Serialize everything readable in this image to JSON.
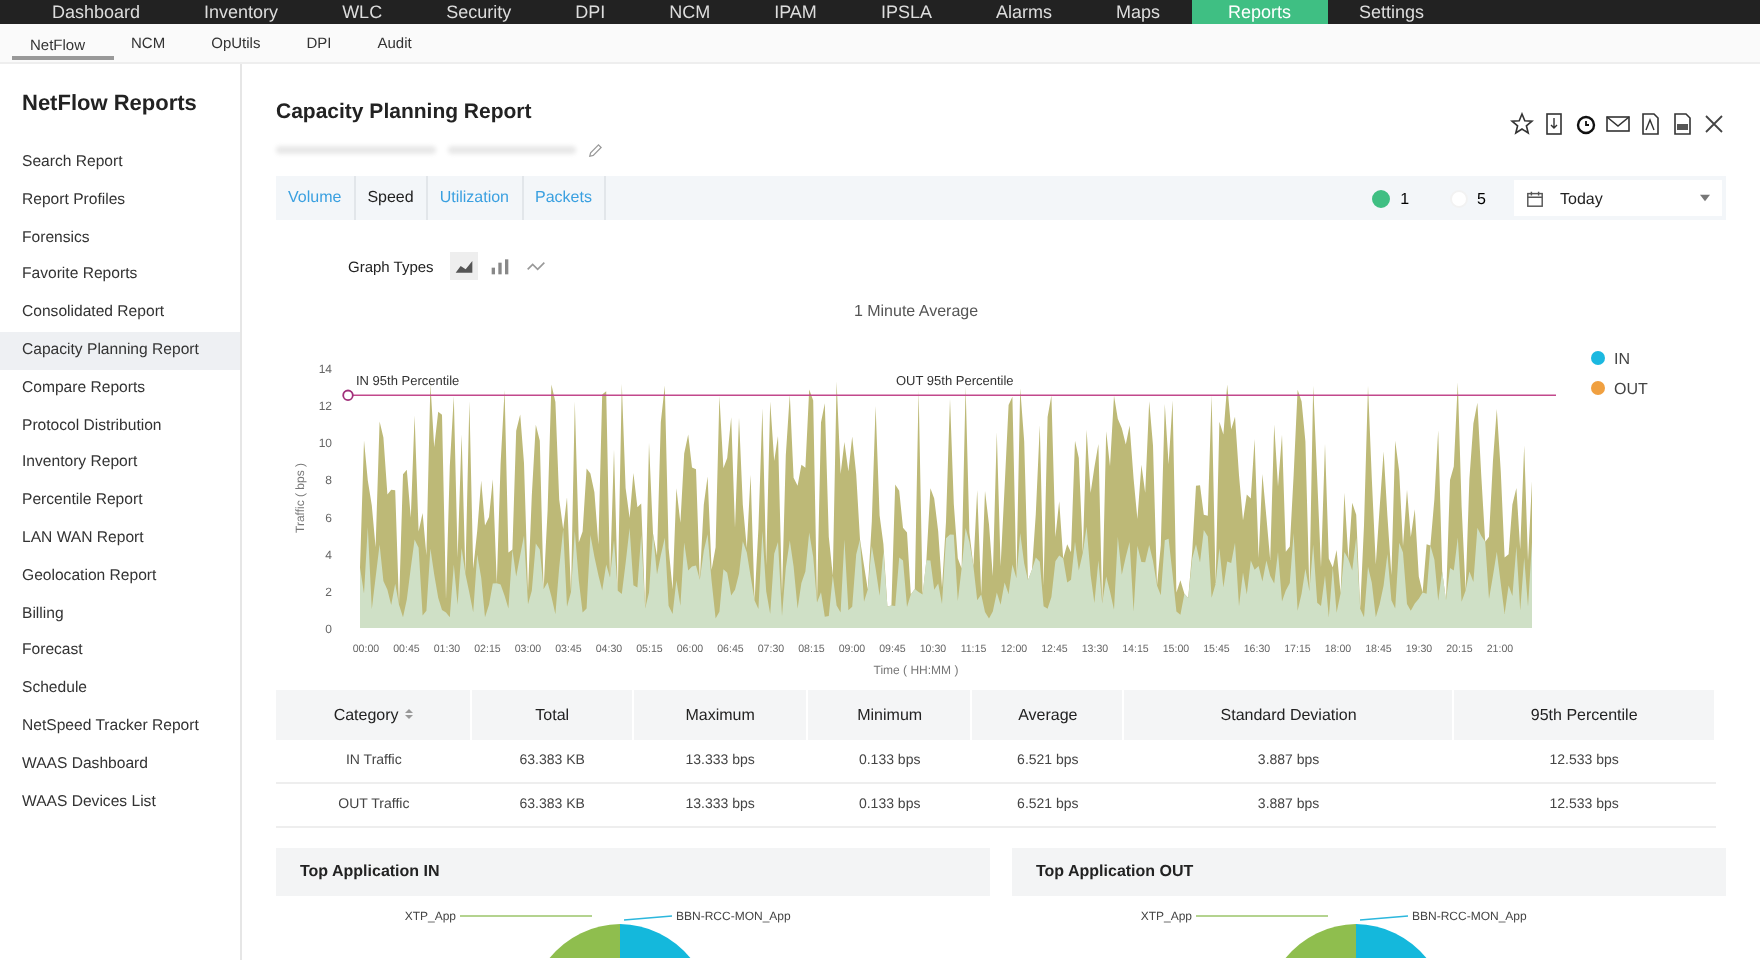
{
  "top_nav": [
    {
      "label": "Dashboard",
      "selected": false
    },
    {
      "label": "Inventory",
      "selected": false
    },
    {
      "label": "WLC",
      "selected": false
    },
    {
      "label": "Security",
      "selected": false
    },
    {
      "label": "DPI",
      "selected": false
    },
    {
      "label": "NCM",
      "selected": false
    },
    {
      "label": "IPAM",
      "selected": false
    },
    {
      "label": "IPSLA",
      "selected": false
    },
    {
      "label": "Alarms",
      "selected": false
    },
    {
      "label": "Maps",
      "selected": false
    },
    {
      "label": "Reports",
      "selected": true
    },
    {
      "label": "Settings",
      "selected": false
    }
  ],
  "sub_nav": [
    {
      "label": "NetFlow",
      "selected": true
    },
    {
      "label": "NCM",
      "selected": false
    },
    {
      "label": "OpUtils",
      "selected": false
    },
    {
      "label": "DPI",
      "selected": false
    },
    {
      "label": "Audit",
      "selected": false
    }
  ],
  "sidebar": {
    "title": "NetFlow Reports",
    "items": [
      {
        "label": "Search Report",
        "selected": false
      },
      {
        "label": "Report Profiles",
        "selected": false
      },
      {
        "label": "Forensics",
        "selected": false
      },
      {
        "label": "Favorite Reports",
        "selected": false
      },
      {
        "label": "Consolidated Report",
        "selected": false
      },
      {
        "label": "Capacity Planning Report",
        "selected": true
      },
      {
        "label": "Compare Reports",
        "selected": false
      },
      {
        "label": "Protocol Distribution",
        "selected": false
      },
      {
        "label": "Inventory Report",
        "selected": false
      },
      {
        "label": "Percentile Report",
        "selected": false
      },
      {
        "label": "LAN WAN Report",
        "selected": false
      },
      {
        "label": "Geolocation Report",
        "selected": false
      },
      {
        "label": "Billing",
        "selected": false
      },
      {
        "label": "Forecast",
        "selected": false
      },
      {
        "label": "Schedule",
        "selected": false
      },
      {
        "label": "NetSpeed Tracker Report",
        "selected": false
      },
      {
        "label": "WAAS Dashboard",
        "selected": false
      },
      {
        "label": "WAAS Devices List",
        "selected": false
      }
    ]
  },
  "report": {
    "title": "Capacity Planning Report"
  },
  "view_tabs": [
    {
      "label": "Volume",
      "selected": false
    },
    {
      "label": "Speed",
      "selected": true
    },
    {
      "label": "Utilization",
      "selected": false
    },
    {
      "label": "Packets",
      "selected": false
    }
  ],
  "intervals": [
    {
      "label": "1",
      "selected": true
    },
    {
      "label": "5",
      "selected": false
    }
  ],
  "date_range": {
    "value": "Today"
  },
  "graph_types": {
    "label": "Graph Types",
    "options": [
      {
        "kind": "area",
        "selected": true
      },
      {
        "kind": "bar",
        "selected": false
      },
      {
        "kind": "line",
        "selected": false
      }
    ]
  },
  "chart": {
    "title": "1 Minute Average",
    "ylabel": "Traffic ( bps )",
    "xlabel": "Time ( HH:MM )",
    "yticks": [
      "14",
      "12",
      "10",
      "8",
      "6",
      "4",
      "2",
      "0"
    ],
    "xticks": [
      "00:00",
      "00:45",
      "01:30",
      "02:15",
      "03:00",
      "03:45",
      "04:30",
      "05:15",
      "06:00",
      "06:45",
      "07:30",
      "08:15",
      "09:00",
      "09:45",
      "10:30",
      "11:15",
      "12:00",
      "12:45",
      "13:30",
      "14:15",
      "15:00",
      "15:45",
      "16:30",
      "17:15",
      "18:00",
      "18:45",
      "19:30",
      "20:15",
      "21:00"
    ],
    "percentile_labels": [
      "IN 95th Percentile",
      "OUT 95th Percentile"
    ],
    "legend": [
      {
        "name": "IN",
        "color": "#1bb8e0"
      },
      {
        "name": "OUT",
        "color": "#f0a040"
      }
    ]
  },
  "table": {
    "columns": [
      "Category",
      "Total",
      "Maximum",
      "Minimum",
      "Average",
      "Standard Deviation",
      "95th Percentile"
    ],
    "rows": [
      [
        "IN Traffic",
        "63.383 KB",
        "13.333 bps",
        "0.133 bps",
        "6.521 bps",
        "3.887 bps",
        "12.533 bps"
      ],
      [
        "OUT Traffic",
        "63.383 KB",
        "13.333 bps",
        "0.133 bps",
        "6.521 bps",
        "3.887 bps",
        "12.533 bps"
      ]
    ]
  },
  "panels": [
    {
      "title": "Top Application IN",
      "labels": [
        "XTP_App",
        "BBN-RCC-MON_App"
      ]
    },
    {
      "title": "Top Application OUT",
      "labels": [
        "XTP_App",
        "BBN-RCC-MON_App"
      ]
    }
  ]
}
